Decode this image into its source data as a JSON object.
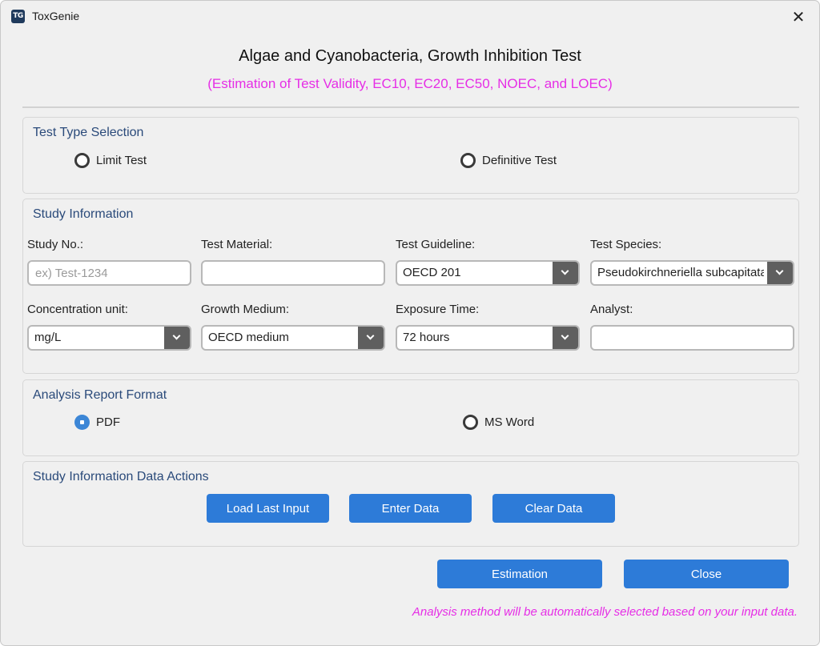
{
  "window": {
    "app_title": "ToxGenie",
    "icon_text": "TG",
    "close_glyph": "✕"
  },
  "header": {
    "title": "Algae and Cyanobacteria, Growth Inhibition Test",
    "subtitle": "(Estimation of Test Validity, EC10, EC20, EC50, NOEC, and LOEC)"
  },
  "test_type": {
    "title": "Test Type Selection",
    "options": [
      {
        "label": "Limit Test",
        "checked": false
      },
      {
        "label": "Definitive Test",
        "checked": false
      }
    ]
  },
  "study_info": {
    "title": "Study Information",
    "study_no": {
      "label": "Study No.:",
      "placeholder": "ex) Test-1234",
      "value": ""
    },
    "test_material": {
      "label": "Test Material:",
      "value": ""
    },
    "test_guideline": {
      "label": "Test Guideline:",
      "value": "OECD 201"
    },
    "test_species": {
      "label": "Test Species:",
      "value": "Pseudokirchneriella subcapitata"
    },
    "concentration_unit": {
      "label": "Concentration unit:",
      "value": "mg/L"
    },
    "growth_medium": {
      "label": "Growth Medium:",
      "value": "OECD medium"
    },
    "exposure_time": {
      "label": "Exposure Time:",
      "value": "72 hours"
    },
    "analyst": {
      "label": "Analyst:",
      "value": ""
    }
  },
  "report_format": {
    "title": "Analysis Report Format",
    "options": [
      {
        "label": "PDF",
        "checked": true
      },
      {
        "label": "MS Word",
        "checked": false
      }
    ]
  },
  "data_actions": {
    "title": "Study Information Data Actions",
    "load_label": "Load Last Input",
    "enter_label": "Enter Data",
    "clear_label": "Clear Data"
  },
  "footer": {
    "estimation_label": "Estimation",
    "close_label": "Close",
    "note": "Analysis method will be automatically selected based on your input data."
  },
  "colors": {
    "accent": "#2d7bd8",
    "magenta": "#e62ee6",
    "section_title": "#2a4a7a"
  }
}
